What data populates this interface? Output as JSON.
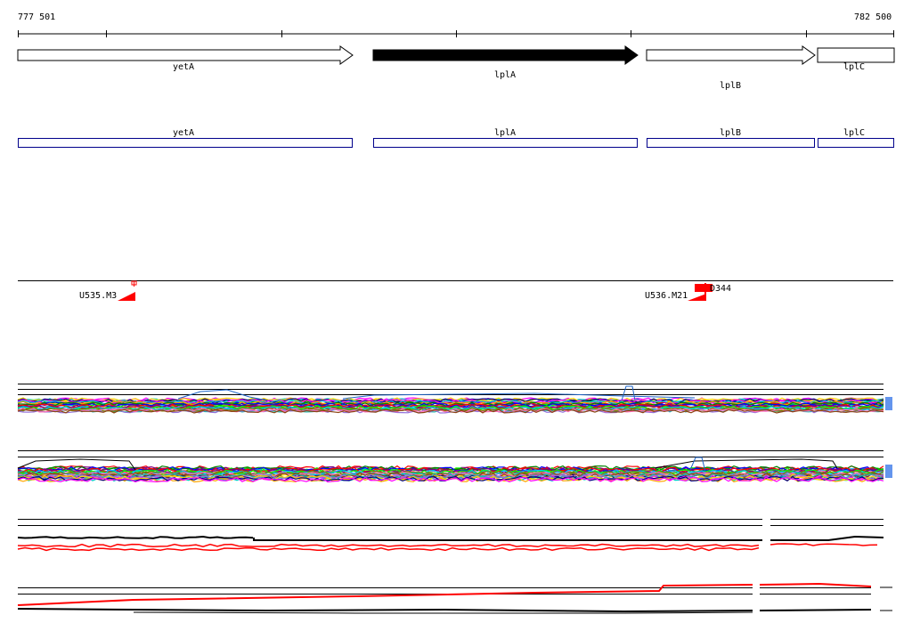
{
  "ruler": {
    "start_label": "777 501",
    "end_label": "782 500"
  },
  "genes": [
    {
      "name": "yetA",
      "strand": "+",
      "highlighted": false
    },
    {
      "name": "lplA",
      "strand": "+",
      "highlighted": true
    },
    {
      "name": "lplB",
      "strand": "+",
      "highlighted": false
    },
    {
      "name": "lplC",
      "strand": "+",
      "highlighted": false
    }
  ],
  "annotations": [
    {
      "name": "yetA"
    },
    {
      "name": "lplA"
    },
    {
      "name": "lplB"
    },
    {
      "name": "lplC"
    }
  ],
  "markers": [
    {
      "label": "U535.M3"
    },
    {
      "label": "U536.M21"
    },
    {
      "label": "D344"
    }
  ],
  "colors": {
    "gene_fill_highlight": "#000000",
    "gene_fill": "#ffffff",
    "annotation_box": "#00008b",
    "marker": "#ff0000",
    "track_black": "#000000",
    "track_red": "#ff0000"
  }
}
